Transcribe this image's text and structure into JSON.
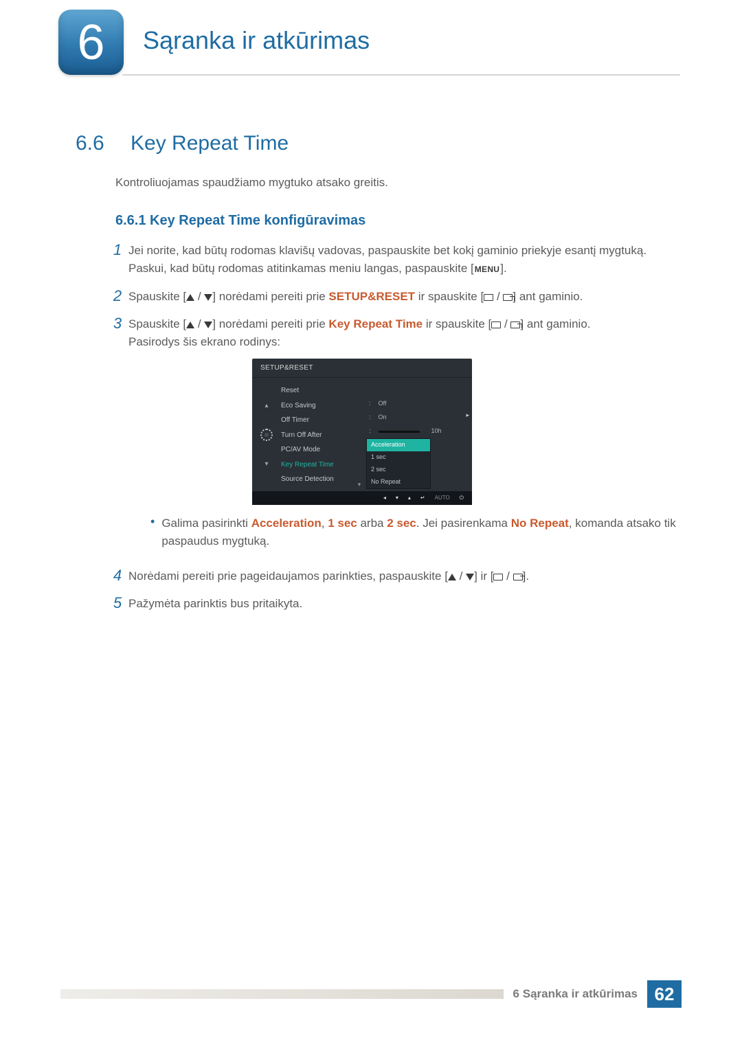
{
  "chapter": {
    "number": "6",
    "title": "Sąranka ir atkūrimas"
  },
  "section": {
    "number": "6.6",
    "title": "Key Repeat Time"
  },
  "intro": "Kontroliuojamas spaudžiamo mygtuko atsako greitis.",
  "subsection": "6.6.1  Key Repeat Time konfigūravimas",
  "steps": {
    "s1": {
      "num": "1",
      "line1_a": "Jei norite, kad būtų rodomas klavišų vadovas, paspauskite bet kokį gaminio priekyje esantį mygtuką.",
      "line2_a": "Paskui, kad būtų rodomas atitinkamas meniu langas, paspauskite [",
      "menu": "MENU",
      "line2_b": "]."
    },
    "s2": {
      "num": "2",
      "pre": "Spauskite [",
      "mid": "] norėdami pereiti prie ",
      "target": "SETUP&RESET",
      "post_a": " ir spauskite [",
      "post_b": "] ant gaminio."
    },
    "s3": {
      "num": "3",
      "pre": "Spauskite [",
      "mid": "] norėdami pereiti prie ",
      "target": "Key Repeat Time",
      "post_a": " ir spauskite [",
      "post_b": "] ant gaminio.",
      "tail": "Pasirodys šis ekrano rodinys:"
    },
    "bullet": {
      "a": "Galima pasirinkti ",
      "opt1": "Acceleration",
      "sep1": ", ",
      "opt2": "1 sec",
      "sep2": " arba ",
      "opt3": "2 sec",
      "sep3": ". Jei pasirenkama ",
      "opt4": "No Repeat",
      "b": ", komanda atsako tik paspaudus mygtuką."
    },
    "s4": {
      "num": "4",
      "pre": "Norėdami pereiti prie pageidaujamos parinkties, paspauskite [",
      "mid": "] ir [",
      "post": "]."
    },
    "s5": {
      "num": "5",
      "text": "Pažymėta parinktis bus pritaikyta."
    }
  },
  "osd": {
    "title": "SETUP&RESET",
    "items": {
      "reset": "Reset",
      "eco": "Eco Saving",
      "offtimer": "Off Timer",
      "turnoff": "Turn Off After",
      "pcav": "PC/AV Mode",
      "krt": "Key Repeat Time",
      "src": "Source Detection"
    },
    "vals": {
      "eco": "Off",
      "offtimer": "On",
      "slider_label": "10h"
    },
    "popup": {
      "sel": "Acceleration",
      "o1": "1 sec",
      "o2": "2 sec",
      "o3": "No Repeat"
    },
    "footer": {
      "auto": "AUTO"
    }
  },
  "footer": {
    "label": "6 Sąranka ir atkūrimas",
    "page": "62"
  }
}
